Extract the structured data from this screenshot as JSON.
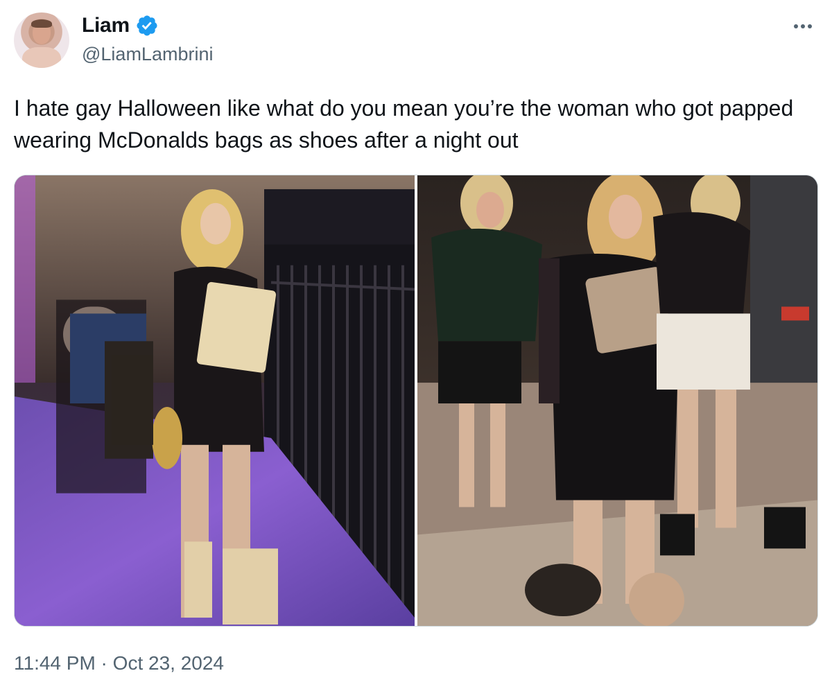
{
  "author": {
    "display_name": "Liam",
    "handle": "@LiamLambrini",
    "verified": true,
    "avatar_icon": "profile-photo",
    "verified_icon": "verified-badge-icon",
    "verified_color": "#1d9bf0"
  },
  "menu": {
    "icon": "more-options-icon"
  },
  "tweet": {
    "text": "I hate gay Halloween like what do you mean you’re the woman who got papped wearing McDonalds bags as shoes after a night out"
  },
  "media": {
    "count": 2
  },
  "meta": {
    "time": "11:44 PM",
    "separator": " · ",
    "date": "Oct 23, 2024"
  },
  "colors": {
    "text_primary": "#0f1419",
    "text_secondary": "#536471",
    "border": "#cfd9de"
  }
}
